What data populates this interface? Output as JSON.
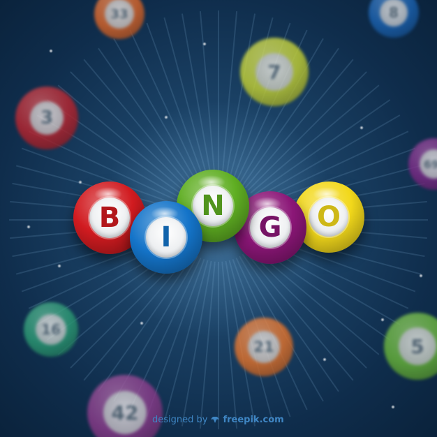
{
  "title_balls": [
    {
      "letter": "B",
      "color": "#d11b20"
    },
    {
      "letter": "I",
      "color": "#1474c9"
    },
    {
      "letter": "N",
      "color": "#5fae22"
    },
    {
      "letter": "G",
      "color": "#8b1677"
    },
    {
      "letter": "O",
      "color": "#f2d81b"
    }
  ],
  "background_balls": [
    {
      "number": "33",
      "color": "#d8652a"
    },
    {
      "number": "8",
      "color": "#1b62b0"
    },
    {
      "number": "7",
      "color": "#c2cf35"
    },
    {
      "number": "3",
      "color": "#b8252f"
    },
    {
      "number": "69",
      "color": "#7b2a86"
    },
    {
      "number": "16",
      "color": "#2c9a74"
    },
    {
      "number": "21",
      "color": "#e0722c"
    },
    {
      "number": "5",
      "color": "#67b33a"
    },
    {
      "number": "42",
      "color": "#8a3b8a"
    }
  ],
  "credit": {
    "prefix": "designed by",
    "brand": "freepik.com",
    "icon": "freepik-logo-icon"
  }
}
